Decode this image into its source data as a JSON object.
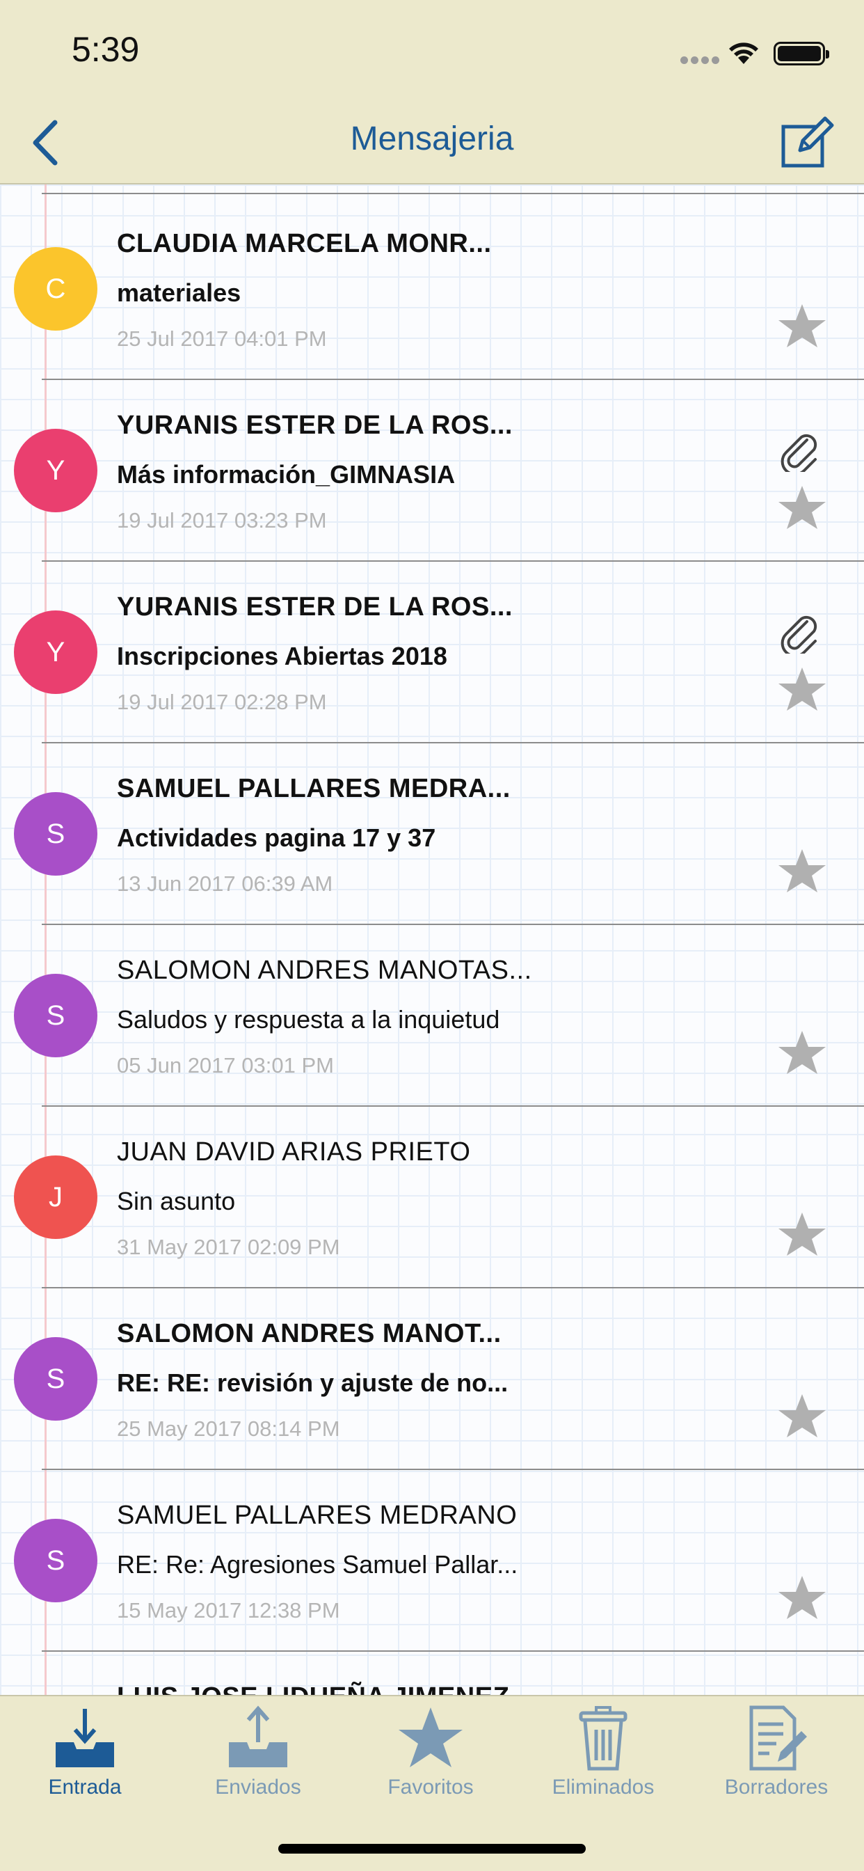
{
  "status_bar": {
    "time": "5:39"
  },
  "nav": {
    "title": "Mensajeria"
  },
  "colors": {
    "accent": "#1d5b96",
    "tab_inactive": "#7b9ab5",
    "star": "#b0b0b0"
  },
  "messages": [
    {
      "sender": "CLAUDIA MARCELA MONR...",
      "subject": "materiales",
      "date": "25 Jul 2017 04:01 PM",
      "initial": "C",
      "avatar_color": "#fbc52c",
      "unread": true,
      "attachment": false
    },
    {
      "sender": "YURANIS ESTER DE LA ROS...",
      "subject": "Más información_GIMNASIA",
      "date": "19 Jul 2017 03:23 PM",
      "initial": "Y",
      "avatar_color": "#ea3f6f",
      "unread": true,
      "attachment": true
    },
    {
      "sender": "YURANIS ESTER DE LA ROS...",
      "subject": "Inscripciones Abiertas 2018",
      "date": "19 Jul 2017 02:28 PM",
      "initial": "Y",
      "avatar_color": "#ea3f6f",
      "unread": true,
      "attachment": true
    },
    {
      "sender": "SAMUEL PALLARES MEDRA...",
      "subject": "Actividades pagina 17 y 37",
      "date": "13 Jun 2017 06:39 AM",
      "initial": "S",
      "avatar_color": "#a84fc8",
      "unread": true,
      "attachment": false
    },
    {
      "sender": "SALOMON ANDRES MANOTAS...",
      "subject": "Saludos y respuesta a la inquietud",
      "date": "05 Jun 2017 03:01 PM",
      "initial": "S",
      "avatar_color": "#a84fc8",
      "unread": false,
      "attachment": false
    },
    {
      "sender": "JUAN DAVID ARIAS PRIETO",
      "subject": "Sin asunto",
      "date": "31 May 2017 02:09 PM",
      "initial": "J",
      "avatar_color": "#ef5350",
      "unread": false,
      "attachment": false
    },
    {
      "sender": "SALOMON ANDRES MANOT...",
      "subject": "RE: RE: revisión y ajuste de no...",
      "date": "25 May 2017 08:14 PM",
      "initial": "S",
      "avatar_color": "#a84fc8",
      "unread": true,
      "attachment": false
    },
    {
      "sender": "SAMUEL PALLARES MEDRANO",
      "subject": "RE: Re: Agresiones Samuel Pallar...",
      "date": "15 May 2017 12:38 PM",
      "initial": "S",
      "avatar_color": "#a84fc8",
      "unread": false,
      "attachment": false
    },
    {
      "sender": "LUIS JOSE LIDUEÑA JIMENEZ",
      "subject": "",
      "date": "",
      "initial": "",
      "avatar_color": "#29a0c8",
      "unread": true,
      "attachment": false
    }
  ],
  "tabs": [
    {
      "label": "Entrada",
      "icon": "inbox-icon",
      "active": true
    },
    {
      "label": "Enviados",
      "icon": "outbox-icon",
      "active": false
    },
    {
      "label": "Favoritos",
      "icon": "star-icon",
      "active": false
    },
    {
      "label": "Eliminados",
      "icon": "trash-icon",
      "active": false
    },
    {
      "label": "Borradores",
      "icon": "drafts-icon",
      "active": false
    }
  ]
}
